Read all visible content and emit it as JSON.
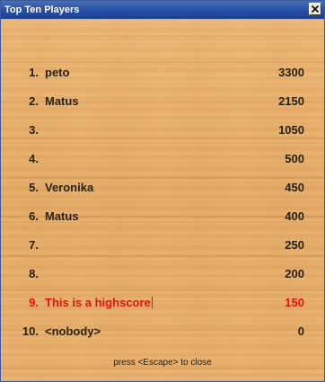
{
  "window": {
    "title": "Top Ten Players",
    "close_icon": "close-x-icon"
  },
  "scores": [
    {
      "rank": "1.",
      "name": "peto",
      "score": "3300",
      "highlighted": false
    },
    {
      "rank": "2.",
      "name": "Matus",
      "score": "2150",
      "highlighted": false
    },
    {
      "rank": "3.",
      "name": "",
      "score": "1050",
      "highlighted": false
    },
    {
      "rank": "4.",
      "name": "",
      "score": "500",
      "highlighted": false
    },
    {
      "rank": "5.",
      "name": "Veronika",
      "score": "450",
      "highlighted": false
    },
    {
      "rank": "6.",
      "name": "Matus",
      "score": "400",
      "highlighted": false
    },
    {
      "rank": "7.",
      "name": "",
      "score": "250",
      "highlighted": false
    },
    {
      "rank": "8.",
      "name": "",
      "score": "200",
      "highlighted": false
    },
    {
      "rank": "9.",
      "name": "This is a highscore",
      "score": "150",
      "highlighted": true
    },
    {
      "rank": "10.",
      "name": "<nobody>",
      "score": "0",
      "highlighted": false
    }
  ],
  "footer": {
    "hint": "press <Escape> to close"
  },
  "colors": {
    "highlight": "#e5120f",
    "text": "#2a2116",
    "title_bar": "#2a52a8"
  }
}
